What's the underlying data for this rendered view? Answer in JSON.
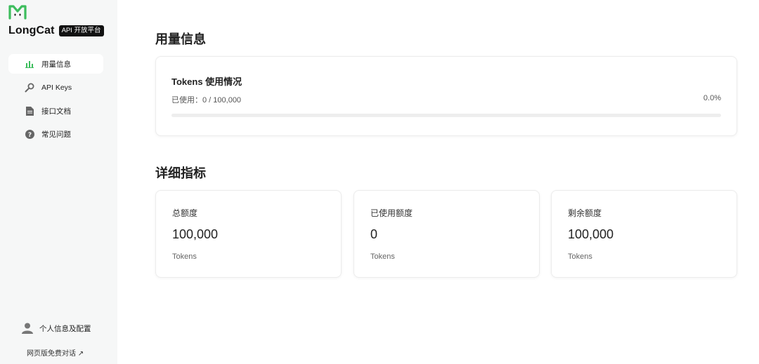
{
  "brand": {
    "name": "LongCat",
    "badge": "API 开放平台",
    "accent_color": "#3dbd5d"
  },
  "sidebar": {
    "items": [
      {
        "label": "用量信息",
        "icon": "bar-chart-icon",
        "active": true
      },
      {
        "label": "API Keys",
        "icon": "key-icon",
        "active": false
      },
      {
        "label": "接口文档",
        "icon": "document-icon",
        "active": false
      },
      {
        "label": "常见问题",
        "icon": "question-circle-icon",
        "active": false
      }
    ],
    "profile_label": "个人信息及配置",
    "web_chat_label": "网页版免费对话 ↗"
  },
  "usage": {
    "section_title": "用量信息",
    "card_title": "Tokens 使用情况",
    "used_text": "已使用：0 / 100,000",
    "percent_text": "0.0%",
    "progress_fraction": 0.0
  },
  "details": {
    "section_title": "详细指标",
    "metrics": [
      {
        "label": "总额度",
        "value": "100,000",
        "unit": "Tokens"
      },
      {
        "label": "已使用额度",
        "value": "0",
        "unit": "Tokens"
      },
      {
        "label": "剩余额度",
        "value": "100,000",
        "unit": "Tokens"
      }
    ]
  }
}
